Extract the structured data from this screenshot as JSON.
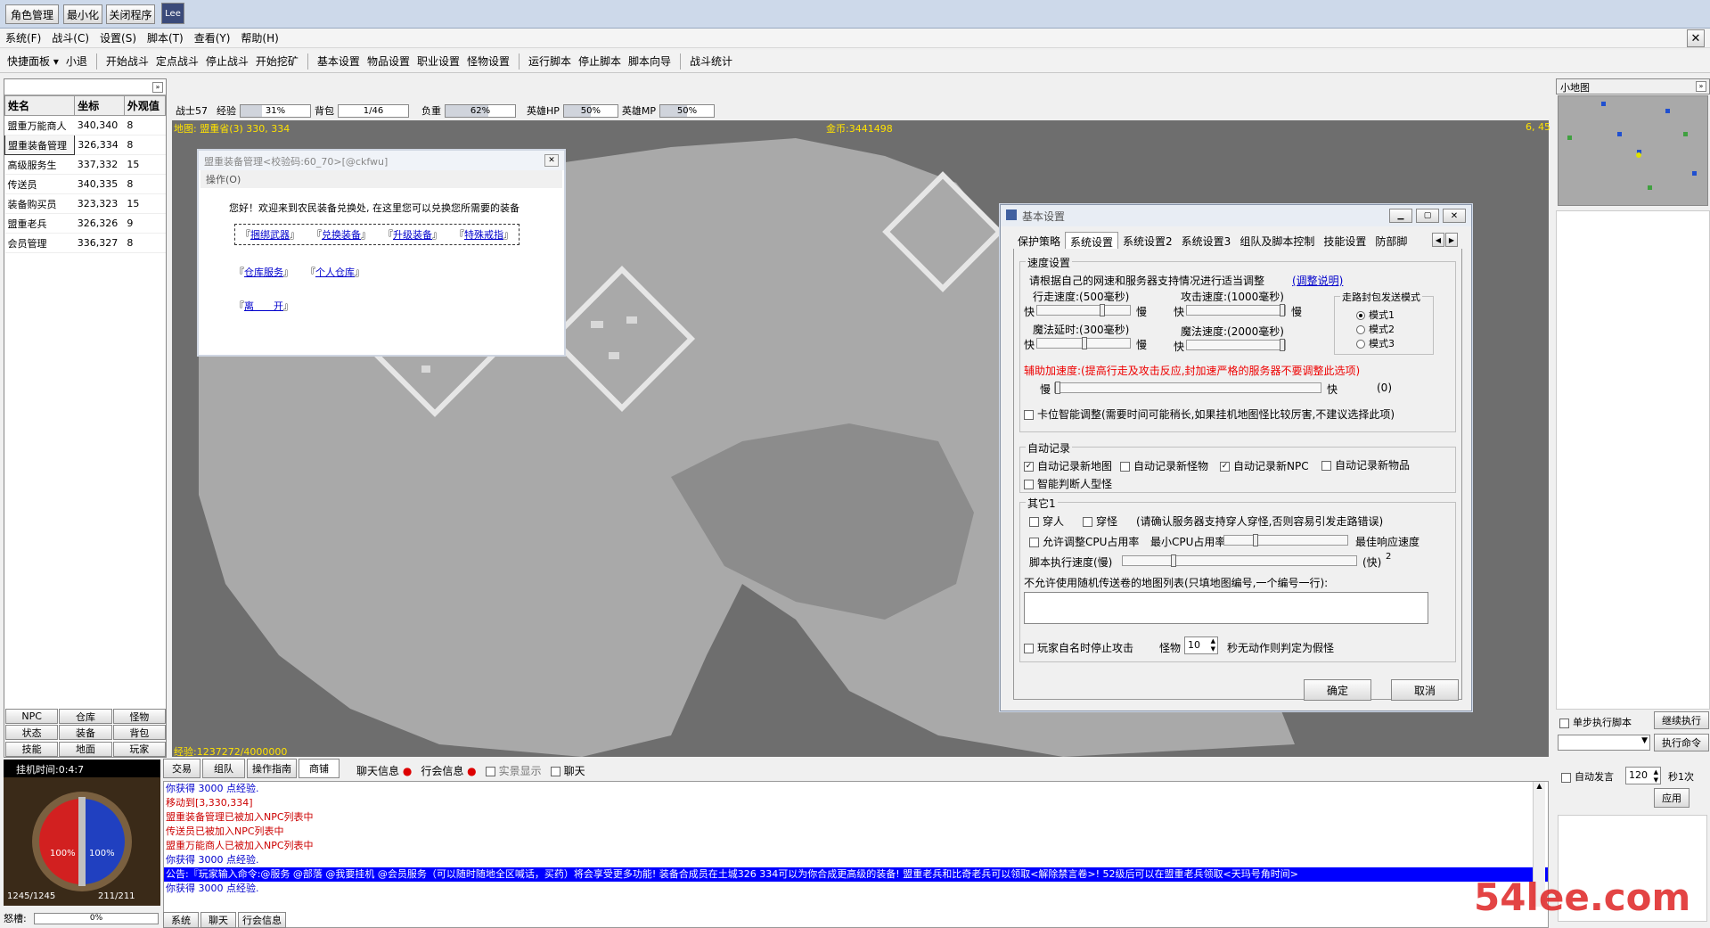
{
  "topbar": {
    "btn_role": "角色管理",
    "btn_min": "最小化",
    "btn_close": "关闭程序",
    "btn_lee": "Lee"
  },
  "menu": [
    "系统(F)",
    "战斗(C)",
    "设置(S)",
    "脚本(T)",
    "查看(Y)",
    "帮助(H)"
  ],
  "toolbar": {
    "g1": [
      "快捷面板 ▾",
      "小退"
    ],
    "g2": [
      "开始战斗",
      "定点战斗",
      "停止战斗",
      "开始挖矿"
    ],
    "g3": [
      "基本设置",
      "物品设置",
      "职业设置",
      "怪物设置"
    ],
    "g4": [
      "运行脚本",
      "停止脚本",
      "脚本向导"
    ],
    "g5": [
      "战斗统计"
    ]
  },
  "npclist": {
    "headers": [
      "姓名",
      "坐标",
      "外观值"
    ],
    "rows": [
      [
        "盟重万能商人",
        "340,340",
        "8"
      ],
      [
        "盟重装备管理",
        "326,334",
        "8"
      ],
      [
        "高级服务生",
        "337,332",
        "15"
      ],
      [
        "传送员",
        "340,335",
        "8"
      ],
      [
        "装备购买员",
        "323,323",
        "15"
      ],
      [
        "盟重老兵",
        "326,326",
        "9"
      ],
      [
        "会员管理",
        "336,327",
        "8"
      ]
    ]
  },
  "leftbtns": [
    "NPC",
    "仓库",
    "怪物",
    "状态",
    "装备",
    "背包",
    "技能",
    "地面",
    "玩家"
  ],
  "stats": {
    "class": "战士",
    "level": "57",
    "exp_label": "经验",
    "exp_pct": "31%",
    "exp_val": 0.31,
    "bag_label": "背包",
    "bag": "1/46",
    "load_label": "负重",
    "load_pct": "62%",
    "load_val": 0.62,
    "hero_hp_label": "英雄HP",
    "hero_hp_pct": "50%",
    "hero_hp_val": 0.5,
    "hero_mp_label": "英雄MP",
    "hero_mp_pct": "50%",
    "hero_mp_val": 0.5
  },
  "map": {
    "name": "地图: 盟重省(3) 330, 334",
    "gold": "金币:3441498",
    "coord": "6, 45",
    "exp": "经验:1237272/4000000"
  },
  "npcdlg": {
    "title": "盟重装备管理<校验码:60_70>[@ckfwu]",
    "ops": "操作(O)",
    "greet": "您好！欢迎来到农民装备兑换处, 在这里您可以兑换您所需要的装备",
    "links": [
      "捆绑武器",
      "兑换装备",
      "升级装备",
      "特殊戒指"
    ],
    "storage": "仓库服务",
    "personal": "个人仓库",
    "leave": "离　　开"
  },
  "settings": {
    "title": "基本设置",
    "tabs": [
      "保护策略",
      "系统设置",
      "系统设置2",
      "系统设置3",
      "组队及脚本控制",
      "技能设置",
      "防部脚策"
    ],
    "speed_group": "速度设置",
    "speed_hint": "请根据自己的网速和服务器支持情况进行适当调整",
    "speed_help": "(调整说明)",
    "walk": "行走速度:(500毫秒)",
    "attack": "攻击速度:(1000毫秒)",
    "magic_delay": "魔法延时:(300毫秒)",
    "magic_speed": "魔法速度:(2000毫秒)",
    "fast": "快",
    "slow": "慢",
    "walk_mode": "走路封包发送模式",
    "modes": [
      "模式1",
      "模式2",
      "模式3"
    ],
    "assist": "辅助加速度:(提高行走及攻击反应,封加速严格的服务器不要调整此选项)",
    "assist_val": "(0)",
    "smart": "卡位智能调整(需要时间可能稍长,如果挂机地图怪比较厉害,不建议选择此项)",
    "auto_group": "自动记录",
    "auto": [
      "自动记录新地图",
      "自动记录新怪物",
      "自动记录新NPC",
      "自动记录新物品"
    ],
    "human_monster": "智能判断人型怪",
    "other_group": "其它1",
    "pass_human": "穿人",
    "pass_monster": "穿怪",
    "pass_hint": "(请确认服务器支持穿人穿怪,否则容易引发走路错误)",
    "cpu_adj": "允许调整CPU占用率",
    "min_cpu": "最小CPU占用率",
    "best_resp": "最佳响应速度",
    "script_speed": "脚本执行速度(慢)",
    "script_fast": "(快)",
    "script_num": "2",
    "map_list": "不允许使用随机传送卷的地图列表(只填地图编号,一个编号一行):",
    "stop_attack": "玩家自名时停止攻击",
    "monster": "怪物",
    "monster_sec": "10",
    "monster_hint": "秒无动作则判定为假怪",
    "ok": "确定",
    "cancel": "取消"
  },
  "right": {
    "minimap": "小地图",
    "step": "单步执行脚本",
    "continue": "继续执行",
    "exec": "执行命令",
    "auto_speak": "自动发言",
    "interval": "120",
    "per_sec": "秒1次",
    "apply": "应用"
  },
  "bottomtabs": [
    "交易",
    "组队",
    "操作指南",
    "商铺"
  ],
  "chatopts": [
    "聊天信息",
    "行会信息",
    "实景显示",
    "聊天"
  ],
  "hangtime": "挂机时间:0:4:7",
  "hp": "100%",
  "mp": "100%",
  "hp_num": "1245/1245",
  "mp_num": "211/211",
  "anger_label": "怒槽:",
  "anger": "0%",
  "chatbottom": [
    "系统",
    "聊天",
    "行会信息"
  ],
  "chat": [
    {
      "t": "你获得 3000 点经验.",
      "c": "#0000cc"
    },
    {
      "t": "移动到[3,330,334]",
      "c": "#cc0000"
    },
    {
      "t": "盟重装备管理已被加入NPC列表中",
      "c": "#cc0000"
    },
    {
      "t": "传送员已被加入NPC列表中",
      "c": "#cc0000"
    },
    {
      "t": "盟重万能商人已被加入NPC列表中",
      "c": "#cc0000"
    },
    {
      "t": "你获得 3000 点经验.",
      "c": "#0000cc"
    },
    {
      "t": "公告:『玩家输入命令:@服务 @部落 @我要挂机 @会员服务（可以随时随地全区喊话，买药）将会享受更多功能! 装备合成员在土城326 334可以为你合成更高级的装备! 盟重老兵和比奇老兵可以领取<解除禁言卷>! 52级后可以在盟重老兵领取<天玛号角时间>",
      "c": "#ffffff",
      "bg": "#0000ff"
    },
    {
      "t": "你获得 3000 点经验.",
      "c": "#0000cc"
    }
  ],
  "watermark": "54lee.com"
}
